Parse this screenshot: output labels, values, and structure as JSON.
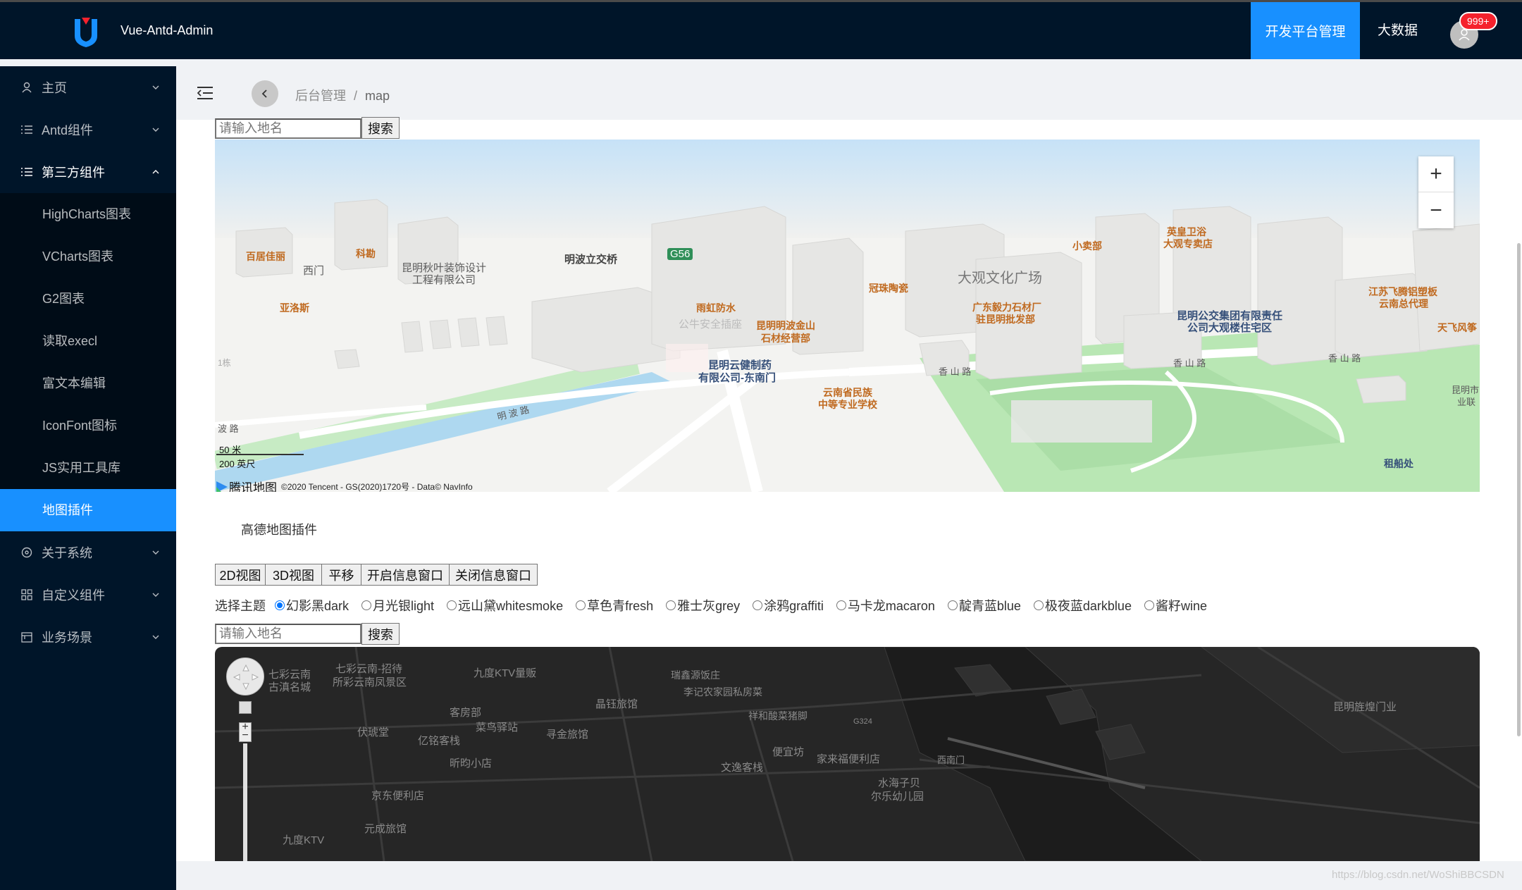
{
  "app": {
    "name": "Vue-Antd-Admin"
  },
  "header": {
    "nav": [
      {
        "label": "开发平台管理",
        "active": true
      },
      {
        "label": "大数据",
        "active": false
      }
    ],
    "badge": "999+"
  },
  "sidebar": {
    "items": [
      {
        "label": "主页",
        "icon": "user-icon"
      },
      {
        "label": "Antd组件",
        "icon": "list-icon"
      },
      {
        "label": "第三方组件",
        "icon": "list-icon",
        "open": true
      },
      {
        "label": "关于系统",
        "icon": "info-circle-icon"
      },
      {
        "label": "自定义组件",
        "icon": "appstore-icon"
      },
      {
        "label": "业务场景",
        "icon": "calendar-icon"
      }
    ],
    "subitems": [
      "HighCharts图表",
      "VCharts图表",
      "G2图表",
      "读取execl",
      "富文本编辑",
      "IconFont图标",
      "JS实用工具库",
      "地图插件"
    ],
    "active_sub": "地图插件"
  },
  "breadcrumb": {
    "parent": "后台管理",
    "sep": "/",
    "current": "map"
  },
  "search1": {
    "placeholder": "请输入地名",
    "button": "搜索"
  },
  "map1": {
    "attribution": "©2020 Tencent - GS(2020)1720号 - Data© NavInfo",
    "brand": "腾讯地图",
    "scale_metric": "50 米",
    "scale_imperial": "200 英尺",
    "zoom_in": "+",
    "zoom_out": "−",
    "labels": {
      "l1": "百居佳丽",
      "l2": "科勘",
      "l3": "西门",
      "l4": "昆明秋叶装饰设计",
      "l5": "工程有限公司",
      "l6": "明波立交桥",
      "l7": "G56",
      "l8": "亚洛斯",
      "l9": "雨虹防水",
      "l10": "公牛安全插座",
      "l11": "昆明明波金山",
      "l12": "石材经营部",
      "l13": "昆明云健制药",
      "l14": "有限公司-东南门",
      "l15": "云南省民族",
      "l16": "中等专业学校",
      "l17": "冠珠陶瓷",
      "l18": "大观文化广场",
      "l19": "广东毅力石材厂",
      "l20": "驻昆明批发部",
      "l21": "小卖部",
      "l22": "英皇卫浴",
      "l23": "大观专卖店",
      "l24": "昆明公交集团有限责任",
      "l25": "公司大观楼住宅区",
      "l26": "江苏飞腾铝塑板",
      "l27": "云南总代理",
      "l28": "天飞风筝",
      "l29": "香 山 路",
      "l30": "香 山 路",
      "l31": "香 山 路",
      "l32": "明 波 路",
      "l33": "波 路",
      "l34": "1栋",
      "l35": "昆明市",
      "l36": "业联",
      "l37": "租船处"
    }
  },
  "plugin_title": "高德地图插件",
  "view_buttons": [
    "2D视图",
    "3D视图",
    "平移",
    "开启信息窗口",
    "关闭信息窗口"
  ],
  "theme": {
    "label": "选择主题",
    "options": [
      "幻影黑dark",
      "月光银light",
      "远山黛whitesmoke",
      "草色青fresh",
      "雅士灰grey",
      "涂鸦graffiti",
      "马卡龙macaron",
      "靛青蓝blue",
      "极夜蓝darkblue",
      "酱籽wine"
    ],
    "selected": "幻影黑dark"
  },
  "search2": {
    "placeholder": "请输入地名",
    "button": "搜索"
  },
  "map2": {
    "labels": {
      "d1": "七彩云南",
      "d2": "古滇名城",
      "d3": "七彩云南-招待",
      "d4": "所彩云南凤景区",
      "d5": "九度KTV量贩",
      "d6": "瑞鑫源饭庄",
      "d7": "李记农家园私房菜",
      "d8": "晶钰旅馆",
      "d9": "客房部",
      "d10": "菜鸟驿站",
      "d11": "伏琥堂",
      "d12": "亿铭客栈",
      "d13": "寻金旅馆",
      "d14": "祥和酸菜猪脚",
      "d15": "G324",
      "d16": "昕昀小店",
      "d17": "便宜坊",
      "d18": "家来福便利店",
      "d19": "西南门",
      "d20": "文逸客栈",
      "d21": "水海子贝",
      "d22": "尔乐幼儿园",
      "d23": "京东便利店",
      "d24": "元成旅馆",
      "d25": "九度KTV",
      "d26": "昆明旌煌门业"
    }
  },
  "watermark": "https://blog.csdn.net/WoShiBBCSDN"
}
